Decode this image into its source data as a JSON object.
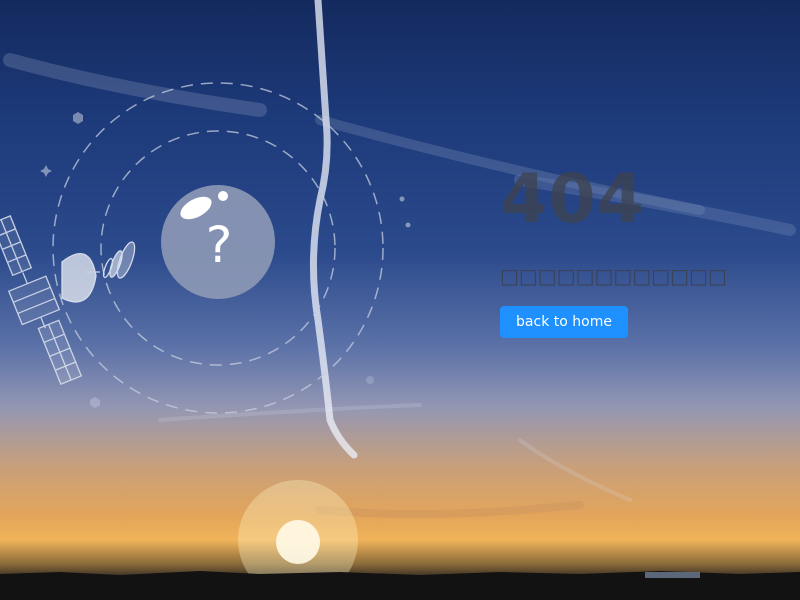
{
  "error": {
    "code": "404",
    "message": "□□□□□□□□□□□□",
    "button_label": "back to home"
  },
  "icons": {
    "satellite": "satellite-icon",
    "planet": "question-planet-icon",
    "question": "question-mark-icon"
  },
  "colors": {
    "button_bg": "#1e90ff",
    "button_text": "#ffffff",
    "code_text": "#3e4250",
    "orbit_stroke": "#c5cde0",
    "planet_fill": "#8c98b5"
  }
}
